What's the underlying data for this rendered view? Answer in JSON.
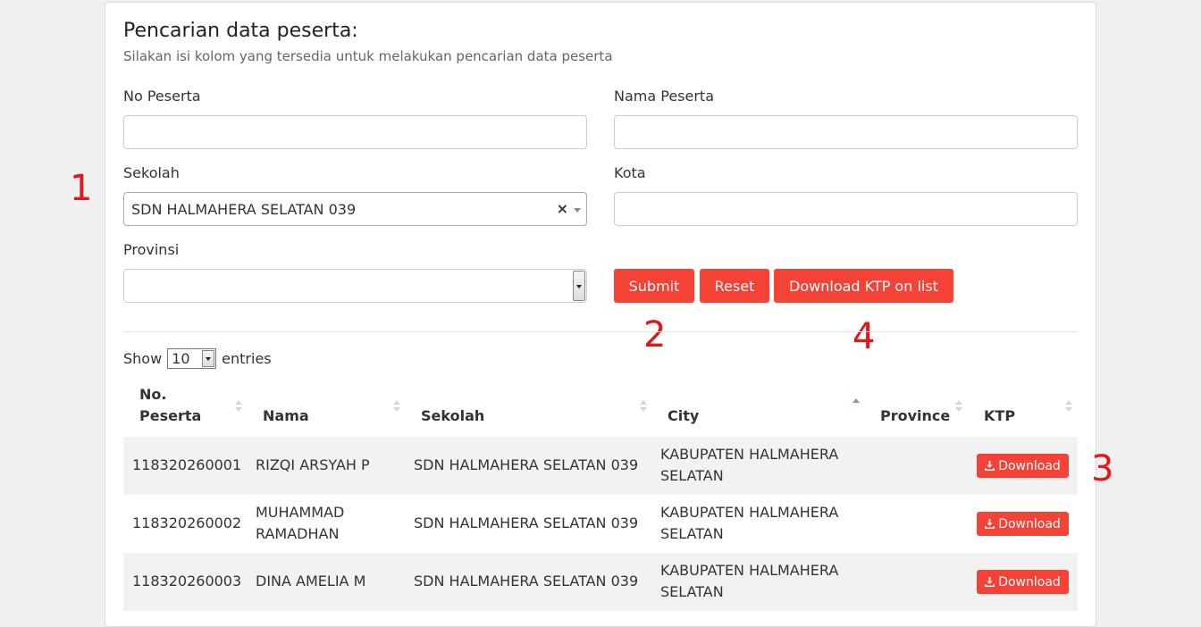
{
  "form": {
    "title": "Pencarian data peserta:",
    "subtitle": "Silakan isi kolom yang tersedia untuk melakukan pencarian data peserta",
    "no_peserta_label": "No Peserta",
    "no_peserta_value": "",
    "nama_label": "Nama Peserta",
    "nama_value": "",
    "sekolah_label": "Sekolah",
    "sekolah_value": "SDN HALMAHERA SELATAN 039",
    "kota_label": "Kota",
    "kota_value": "",
    "provinsi_label": "Provinsi",
    "provinsi_value": ""
  },
  "buttons": {
    "submit": "Submit",
    "reset": "Reset",
    "download_ktp": "Download KTP on list"
  },
  "annotations": [
    "1",
    "2",
    "3",
    "4"
  ],
  "length_control": {
    "show": "Show",
    "value": "10",
    "entries": "entries"
  },
  "table": {
    "headers": {
      "no_line1": "No.",
      "no_line2": "Peserta",
      "nama": "Nama",
      "sekolah": "Sekolah",
      "city": "City",
      "province": "Province",
      "ktp": "KTP"
    },
    "download_label": "Download",
    "rows": [
      {
        "no": "118320260001",
        "nama_1": "RIZQI ARSYAH P",
        "nama_2": "",
        "sekolah": "SDN HALMAHERA SELATAN 039",
        "city_1": "KABUPATEN HALMAHERA",
        "city_2": "SELATAN",
        "province": ""
      },
      {
        "no": "118320260002",
        "nama_1": "MUHAMMAD",
        "nama_2": "RAMADHAN",
        "sekolah": "SDN HALMAHERA SELATAN 039",
        "city_1": "KABUPATEN HALMAHERA",
        "city_2": "SELATAN",
        "province": ""
      },
      {
        "no": "118320260003",
        "nama_1": "DINA AMELIA M",
        "nama_2": "",
        "sekolah": "SDN HALMAHERA SELATAN 039",
        "city_1": "KABUPATEN HALMAHERA",
        "city_2": "SELATAN",
        "province": ""
      }
    ]
  },
  "colors": {
    "accent": "#f44336",
    "annotation": "#e8141c",
    "sort_active": "#8a90c8"
  }
}
